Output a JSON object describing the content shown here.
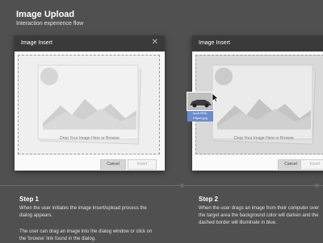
{
  "header": {
    "title": "Image Upload",
    "subtitle": "Interaction experience flow"
  },
  "dialog": {
    "title": "Image Insert",
    "drop_prompt": "Drop Your Image Here or Browse",
    "cancel_label": "Cancel",
    "insert_label": "Insert"
  },
  "drag": {
    "filename": "Audi-RS5-K5pec.jpg"
  },
  "steps": [
    {
      "title": "Step 1",
      "text1": "When the user initiates the image insert/upload process the dialog appears.",
      "text2": "The user can drag an image into the dialog window or click on the 'browse' link found in the dialog."
    },
    {
      "title": "Step 2",
      "text1": "When the user drags an image from their computer over the target area the background color will darken and the dashed border will illuminate in blue."
    }
  ],
  "icons": {
    "close": "close-icon",
    "cursor": "cursor-icon"
  },
  "colors": {
    "background": "#505050",
    "dialog_header": "#3a3a3a",
    "filename_tag": "#6c8ccc"
  }
}
